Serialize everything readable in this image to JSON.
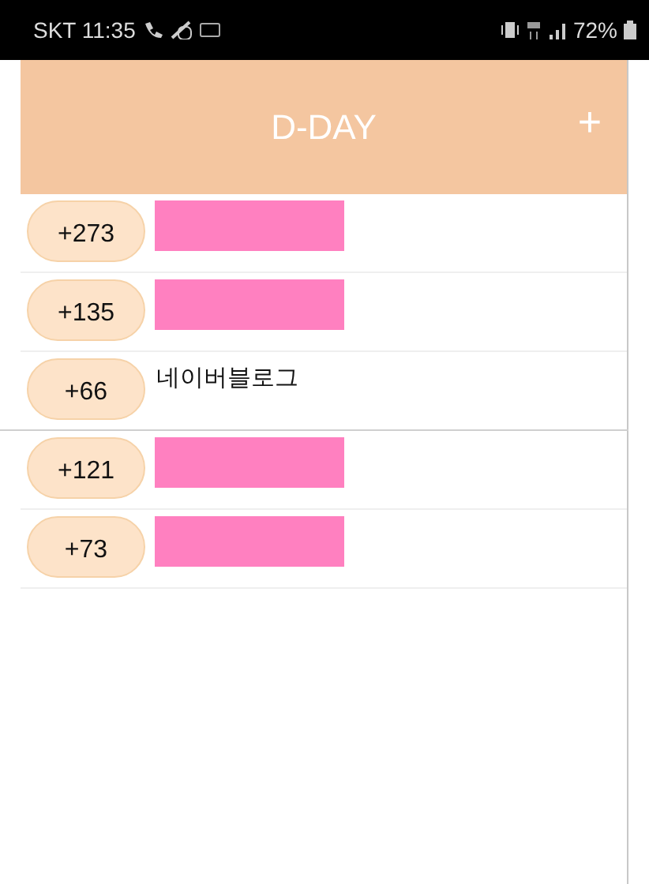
{
  "status_bar": {
    "carrier_time": "SKT 11:35",
    "battery": "72%"
  },
  "header": {
    "title": "D-DAY",
    "add": "+"
  },
  "items": [
    {
      "count": "+273",
      "kind": "redacted",
      "full_width_separator": false
    },
    {
      "count": "+135",
      "kind": "redacted",
      "full_width_separator": false
    },
    {
      "count": "+66",
      "kind": "text",
      "title": "네이버블로그",
      "full_width_separator": true
    },
    {
      "count": "+121",
      "kind": "redacted",
      "full_width_separator": false
    },
    {
      "count": "+73",
      "kind": "redacted",
      "full_width_separator": false
    }
  ]
}
